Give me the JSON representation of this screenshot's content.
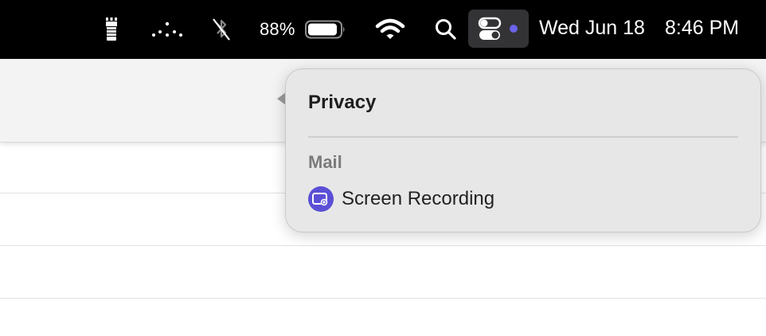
{
  "menubar": {
    "icons": [
      {
        "name": "flashlight-icon"
      },
      {
        "name": "dotted-arc-icon"
      },
      {
        "name": "bluetooth-off-icon"
      },
      {
        "name": "battery-icon"
      },
      {
        "name": "wifi-icon"
      },
      {
        "name": "search-icon"
      },
      {
        "name": "control-center-icon"
      }
    ],
    "battery_percent": "88%",
    "date": "Wed Jun 18",
    "time": "8:46 PM",
    "privacy_dot_color": "#6b63e8"
  },
  "privacy_popover": {
    "title": "Privacy",
    "app_name": "Mail",
    "items": [
      {
        "label": "Screen Recording",
        "icon": "screen-recording-icon",
        "icon_color": "#5b4fd6"
      }
    ]
  }
}
